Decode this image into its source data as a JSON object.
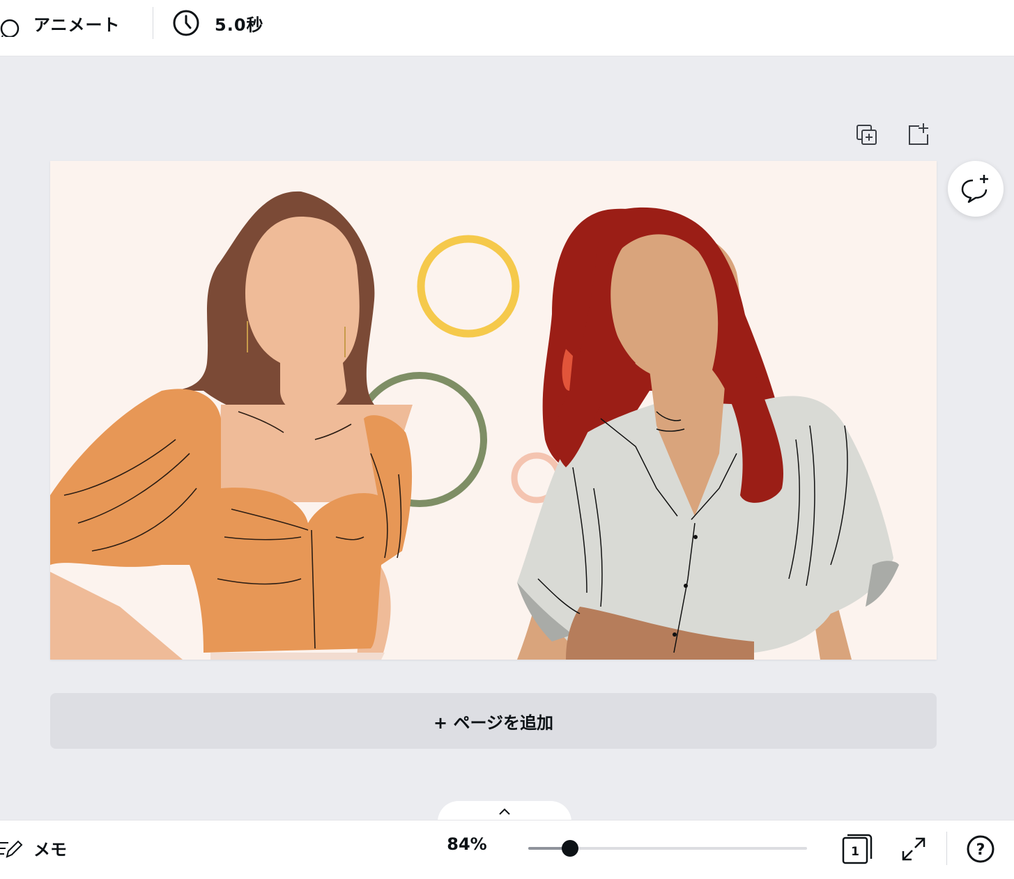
{
  "topbar": {
    "animate_label": "アニメート",
    "duration_label": "5.0秒"
  },
  "page_actions": {
    "duplicate_icon": "duplicate-page-icon",
    "add_icon": "add-page-icon"
  },
  "comment": {
    "icon": "add-comment-icon"
  },
  "add_page": {
    "label": "+ ページを追加"
  },
  "bottombar": {
    "memo_label": "メモ",
    "zoom_label": "84%",
    "zoom_level": 0.15,
    "page_count": "1"
  },
  "colors": {
    "canvas_bg": "#fcf3ee",
    "workspace_bg": "#ebecf0",
    "orange_top": "#e79756",
    "red_hair": "#9b1e16",
    "brown_hair": "#7b4a36",
    "skin_light": "#efbb98",
    "skin_tan": "#d9a47c",
    "white_shirt": "#d9dad5",
    "yellow_ring": "#f5c94b",
    "green_ring": "#7e8e65",
    "pink_ring": "#f4c4b0"
  }
}
